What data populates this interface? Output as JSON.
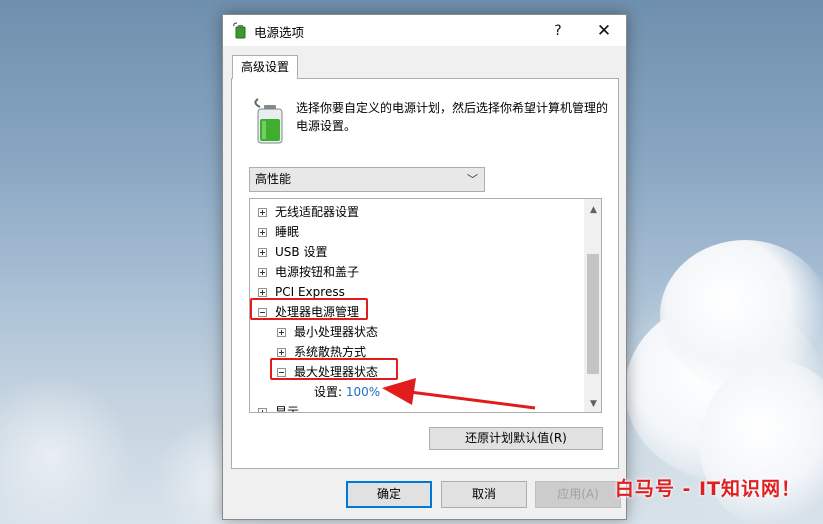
{
  "window": {
    "title": "电源选项",
    "help_label": "?",
    "close_label": "✕"
  },
  "tab": {
    "label": "高级设置"
  },
  "description": "选择你要自定义的电源计划，然后选择你希望计算机管理的电源设置。",
  "plan_select": {
    "value": "高性能"
  },
  "tree": {
    "items": [
      {
        "label": "无线适配器设置",
        "expander": "plus"
      },
      {
        "label": "睡眠",
        "expander": "plus"
      },
      {
        "label": "USB 设置",
        "expander": "plus"
      },
      {
        "label": "电源按钮和盖子",
        "expander": "plus"
      },
      {
        "label": "PCI Express",
        "expander": "plus"
      },
      {
        "label": "处理器电源管理",
        "expander": "minus"
      },
      {
        "label": "最小处理器状态",
        "expander": "plus"
      },
      {
        "label": "系统散热方式",
        "expander": "plus"
      },
      {
        "label": "最大处理器状态",
        "expander": "minus"
      },
      {
        "label": "显示",
        "expander": "plus"
      }
    ],
    "setting": {
      "label": "设置:",
      "value": "100%"
    }
  },
  "buttons": {
    "restore": "还原计划默认值(R)",
    "ok": "确定",
    "cancel": "取消",
    "apply": "应用(A)"
  },
  "watermark": "白马号 - IT知识网！",
  "colors": {
    "highlight": "#e21c1c",
    "accent": "#0078d7",
    "value_blue": "#1e6fc0"
  }
}
